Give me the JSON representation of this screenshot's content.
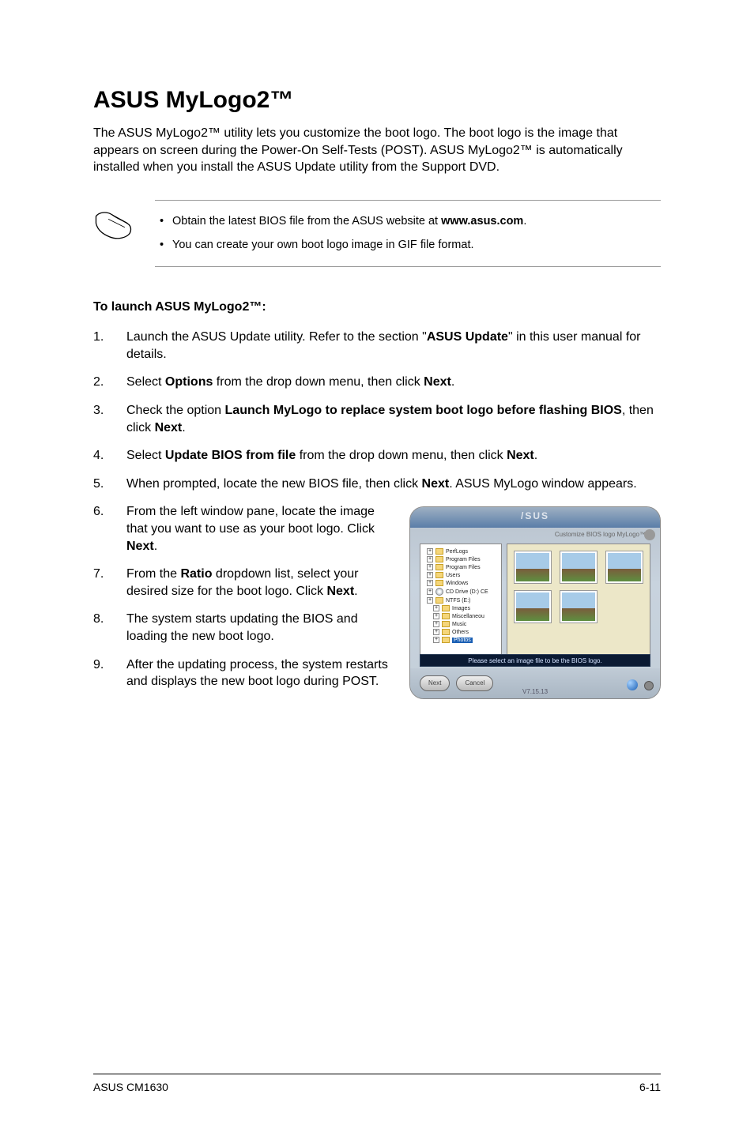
{
  "heading": "ASUS MyLogo2™",
  "intro": "The ASUS MyLogo2™ utility lets you customize the boot logo. The boot logo is the image that appears on screen during the Power-On Self-Tests (POST). ASUS MyLogo2™ is automatically installed when you install the ASUS Update utility from the Support DVD.",
  "notes": {
    "items": [
      {
        "prefix": "Obtain the latest BIOS file from the ASUS website at ",
        "bold": "www.asus.com",
        "suffix": "."
      },
      {
        "prefix": "You can create your own boot logo image in GIF file format.",
        "bold": "",
        "suffix": ""
      }
    ]
  },
  "launch_title": "To launch ASUS MyLogo2™:",
  "steps": [
    {
      "segments": [
        {
          "t": "Launch the ASUS Update utility. Refer to the section \""
        },
        {
          "t": "ASUS Update",
          "b": true
        },
        {
          "t": "\" in this user manual for details."
        }
      ]
    },
    {
      "segments": [
        {
          "t": "Select "
        },
        {
          "t": "Options",
          "b": true
        },
        {
          "t": " from the drop down menu, then click "
        },
        {
          "t": "Next",
          "b": true
        },
        {
          "t": "."
        }
      ]
    },
    {
      "segments": [
        {
          "t": "Check the option "
        },
        {
          "t": "Launch MyLogo to replace system boot logo before flashing BIOS",
          "b": true
        },
        {
          "t": ", then click "
        },
        {
          "t": "Next",
          "b": true
        },
        {
          "t": "."
        }
      ]
    },
    {
      "segments": [
        {
          "t": "Select "
        },
        {
          "t": "Update BIOS from file",
          "b": true
        },
        {
          "t": " from the drop down menu, then click "
        },
        {
          "t": "Next",
          "b": true
        },
        {
          "t": "."
        }
      ]
    },
    {
      "segments": [
        {
          "t": "When prompted, locate the new BIOS file, then click "
        },
        {
          "t": "Next",
          "b": true
        },
        {
          "t": ". ASUS MyLogo window appears."
        }
      ]
    },
    {
      "segments": [
        {
          "t": "From the left window pane, locate the image that you want to use as your boot logo. Click "
        },
        {
          "t": "Next",
          "b": true
        },
        {
          "t": "."
        }
      ]
    },
    {
      "segments": [
        {
          "t": "From the "
        },
        {
          "t": "Ratio",
          "b": true
        },
        {
          "t": " dropdown list, select your desired size for the boot logo. Click "
        },
        {
          "t": "Next",
          "b": true
        },
        {
          "t": "."
        }
      ]
    },
    {
      "segments": [
        {
          "t": "The system starts updating the BIOS and loading the new boot logo."
        }
      ]
    },
    {
      "segments": [
        {
          "t": "After the updating process, the system restarts and displays the new boot logo during POST."
        }
      ]
    }
  ],
  "screenshot": {
    "brand": "/SUS",
    "subtitle": "Customize BIOS logo  MyLogo™",
    "tree": [
      {
        "label": "PerfLogs",
        "indent": false
      },
      {
        "label": "Program Files",
        "indent": false
      },
      {
        "label": "Program Files",
        "indent": false
      },
      {
        "label": "Users",
        "indent": false
      },
      {
        "label": "Windows",
        "indent": false
      },
      {
        "label": "CD Drive (D:) CE",
        "indent": false,
        "cd": true
      },
      {
        "label": "NTFS (E:)",
        "indent": false
      },
      {
        "label": "Images",
        "indent": true
      },
      {
        "label": "Miscellaneou",
        "indent": true
      },
      {
        "label": "Music",
        "indent": true
      },
      {
        "label": "Others",
        "indent": true
      },
      {
        "label": "Photos",
        "indent": true,
        "selected": true
      }
    ],
    "thumb_count": 5,
    "message": "Please select an image file to be the BIOS logo.",
    "buttons": {
      "next": "Next",
      "cancel": "Cancel"
    },
    "version": "V7.15.13"
  },
  "footer": {
    "left": "ASUS CM1630",
    "right": "6-11"
  }
}
